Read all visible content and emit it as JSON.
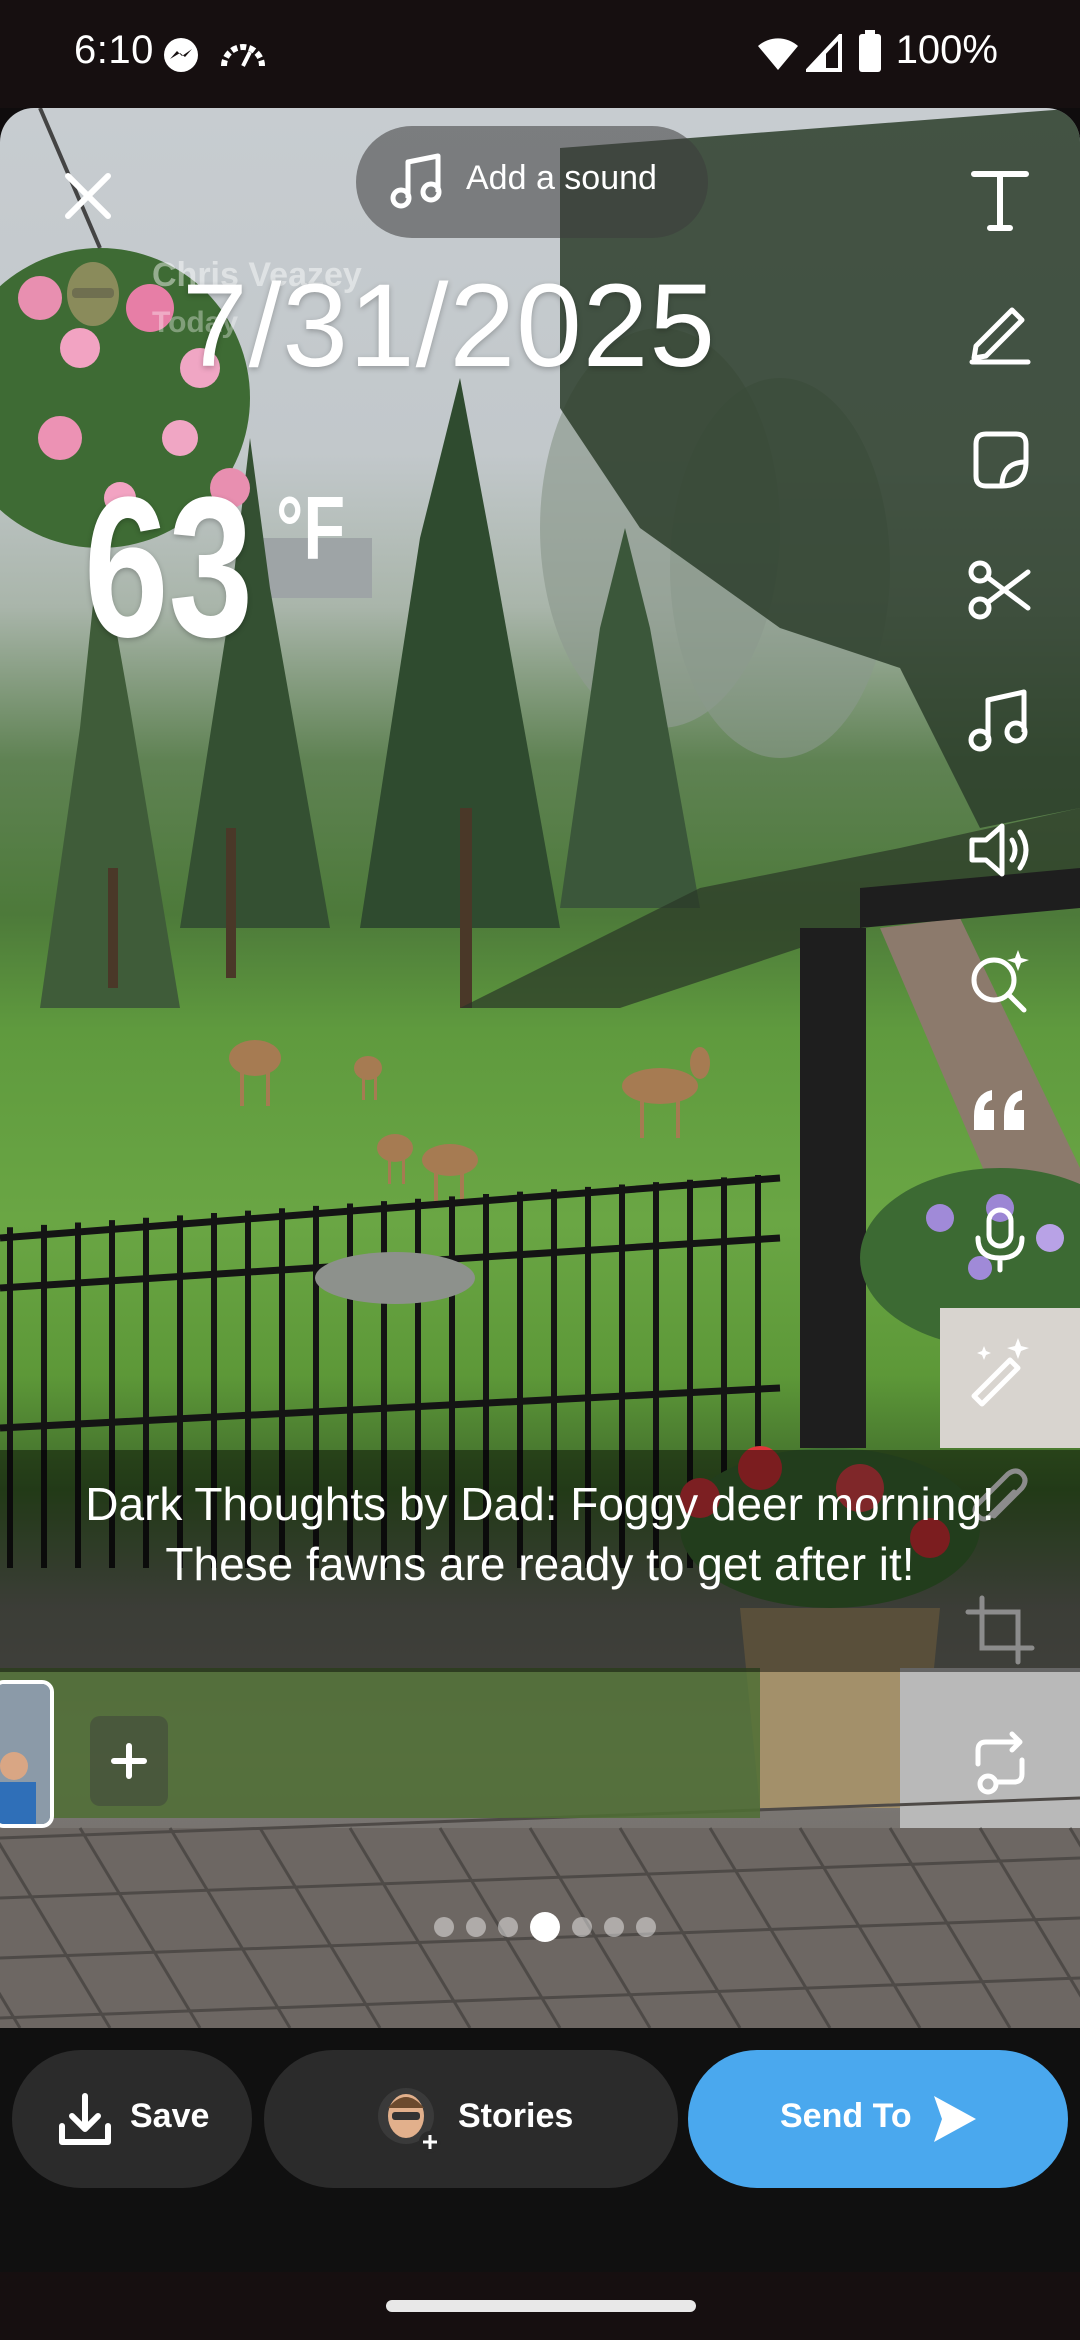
{
  "status_bar": {
    "time": "6:10",
    "battery_text": "100%",
    "icons": [
      "messenger-icon",
      "gauge-icon",
      "wifi-icon",
      "signal-icon",
      "battery-icon"
    ]
  },
  "editor": {
    "sound_label": "Add a sound",
    "ghost_user_name": "Chris Veazey",
    "ghost_user_sub": "Today",
    "date_sticker": "7/31/2025",
    "temperature_value": "63",
    "temperature_unit": "°F",
    "caption": "Dark Thoughts by Dad: Foggy deer morning!  These fawns are ready to get after it!",
    "tools": [
      "text-icon",
      "pencil-icon",
      "sticker-icon",
      "scissors-icon",
      "music-icon",
      "speaker-icon",
      "lens-search-icon",
      "quote-icon",
      "microphone-icon",
      "magic-wand-icon",
      "paperclip-icon",
      "crop-icon",
      "loop-icon"
    ],
    "page_dots": {
      "count": 7,
      "active": 4
    }
  },
  "actions": {
    "save_label": "Save",
    "stories_label": "Stories",
    "send_label": "Send To"
  },
  "colors": {
    "send_button": "#4aa8ee",
    "action_button": "#2b2b2b",
    "background": "#101010"
  }
}
